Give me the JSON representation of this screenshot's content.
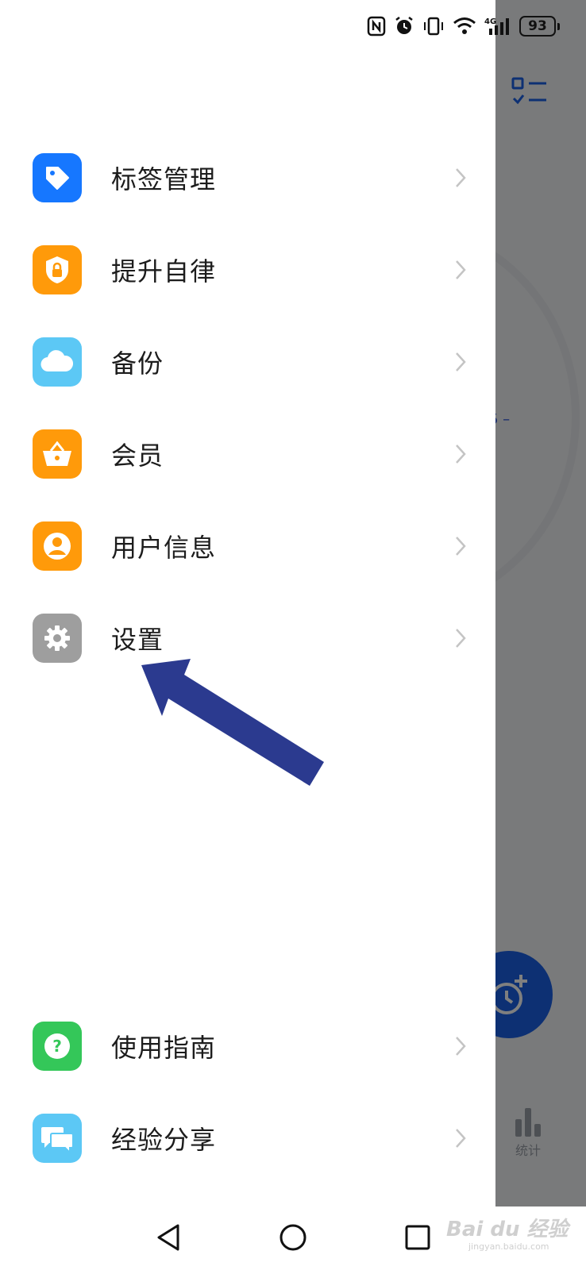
{
  "status_bar": {
    "battery_level": "93",
    "network": "4G",
    "icons": [
      "nfc-icon",
      "alarm-icon",
      "vibrate-icon",
      "wifi-icon",
      "signal-icon",
      "battery-icon"
    ]
  },
  "drawer": {
    "items": [
      {
        "label": "标签管理",
        "icon": "tag-icon",
        "color": "#1677ff"
      },
      {
        "label": "提升自律",
        "icon": "shield-lock-icon",
        "color": "#ff9a0a"
      },
      {
        "label": "备份",
        "icon": "cloud-icon",
        "color": "#5cc8f5"
      },
      {
        "label": "会员",
        "icon": "basket-icon",
        "color": "#ff9a0a"
      },
      {
        "label": "用户信息",
        "icon": "user-icon",
        "color": "#ff9a0a"
      },
      {
        "label": "设置",
        "icon": "gear-icon",
        "color": "#9e9e9e"
      }
    ],
    "bottom_items": [
      {
        "label": "使用指南",
        "icon": "help-icon",
        "color": "#34c759"
      },
      {
        "label": "经验分享",
        "icon": "chat-icon",
        "color": "#5cc8f5"
      }
    ]
  },
  "background": {
    "stats_label": "统计",
    "partial_text": "5 –"
  },
  "annotation": {
    "arrow_color": "#2b3a8f"
  },
  "watermark": {
    "text": "Bai du 经验",
    "sub": "jingyan.baidu.com"
  }
}
